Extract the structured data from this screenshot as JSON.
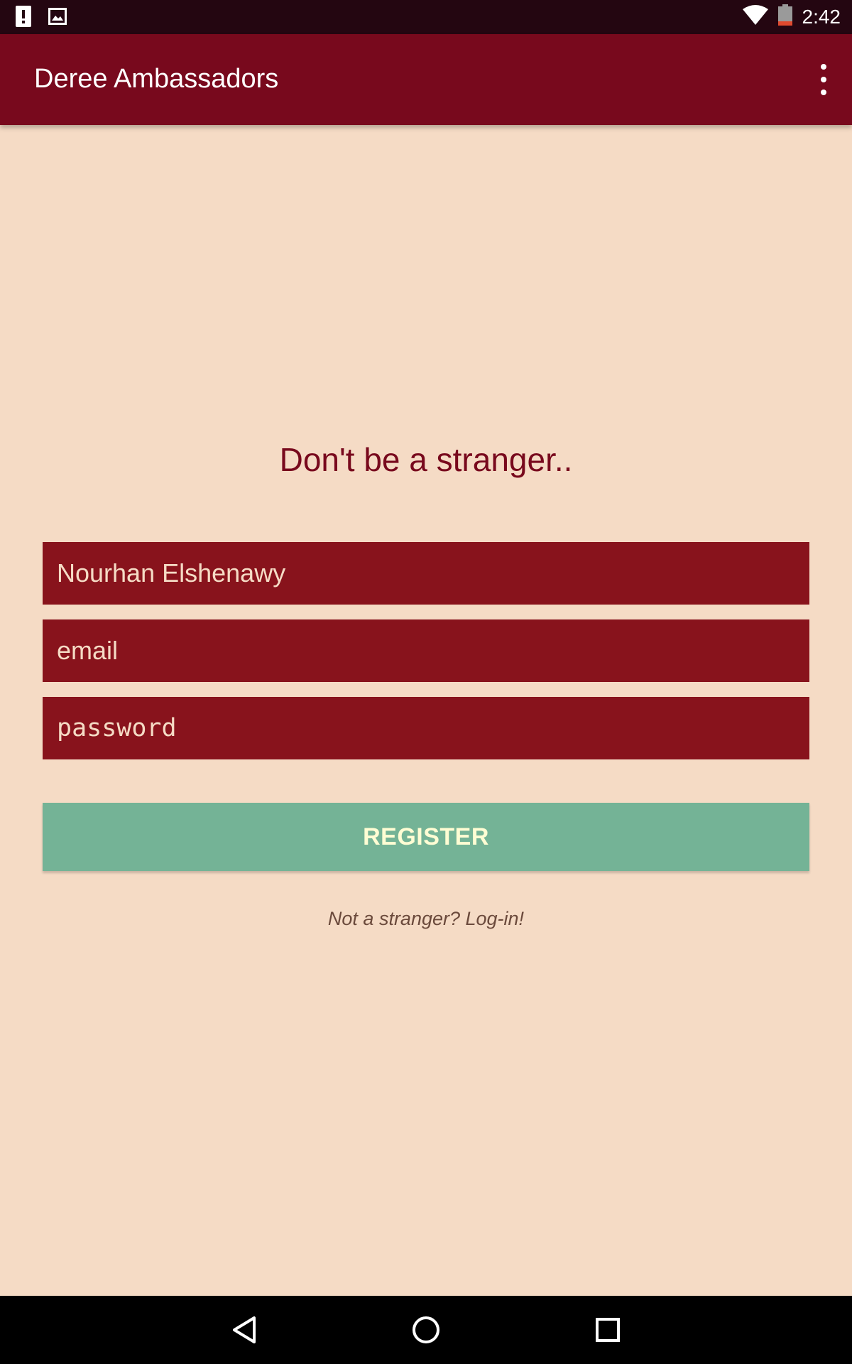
{
  "status_bar": {
    "time": "2:42",
    "icons": [
      "alert-icon",
      "image-icon",
      "wifi-icon",
      "battery-icon"
    ]
  },
  "app_bar": {
    "title": "Deree Ambassadors",
    "overflow_icon": "more-vert-icon"
  },
  "main": {
    "heading": "Don't be a stranger..",
    "name_field": {
      "value": "Nourhan Elshenawy",
      "placeholder": ""
    },
    "email_field": {
      "value": "",
      "placeholder": "email"
    },
    "password_field": {
      "value": "",
      "placeholder": "password"
    },
    "register_label": "REGISTER",
    "login_link": "Not a stranger? Log-in!"
  },
  "nav_bar": {
    "icons": [
      "back-icon",
      "home-icon",
      "recents-icon"
    ]
  },
  "colors": {
    "background": "#f5dbc5",
    "app_bar": "#78091d",
    "status_bar": "#240611",
    "field": "#88131c",
    "button": "#74b396",
    "button_text": "#fffdd4"
  }
}
